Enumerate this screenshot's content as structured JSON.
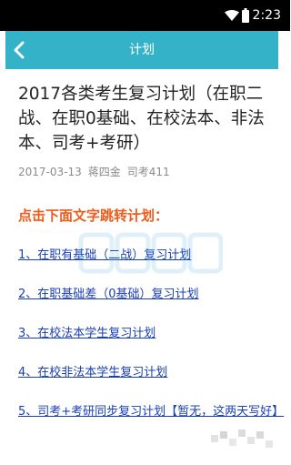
{
  "status_bar": {
    "time": "2:23",
    "icons": [
      "wifi-icon",
      "battery-icon"
    ]
  },
  "app_bar": {
    "title": "计划",
    "back_icon": "chevron-left-icon",
    "color": "#34b3c8"
  },
  "article": {
    "title": "2017各类考生复习计划（在职二战、在职0基础、在校法本、非法本、司考+考研）",
    "date": "2017-03-13",
    "author": "蒋四金",
    "category": "司考411"
  },
  "section_heading": "点击下面文字跳转计划：",
  "plans": [
    "1、在职有基础（二战）复习计划",
    "2、在职基础差（0基础）复习计划",
    "3、在校法本学生复习计划",
    "4、在校非法本学生复习计划",
    "5、司考+考研同步复习计划【暂无，这两天写好】"
  ],
  "colors": {
    "heading": "#f05a1a",
    "link": "#1a3fb5"
  }
}
